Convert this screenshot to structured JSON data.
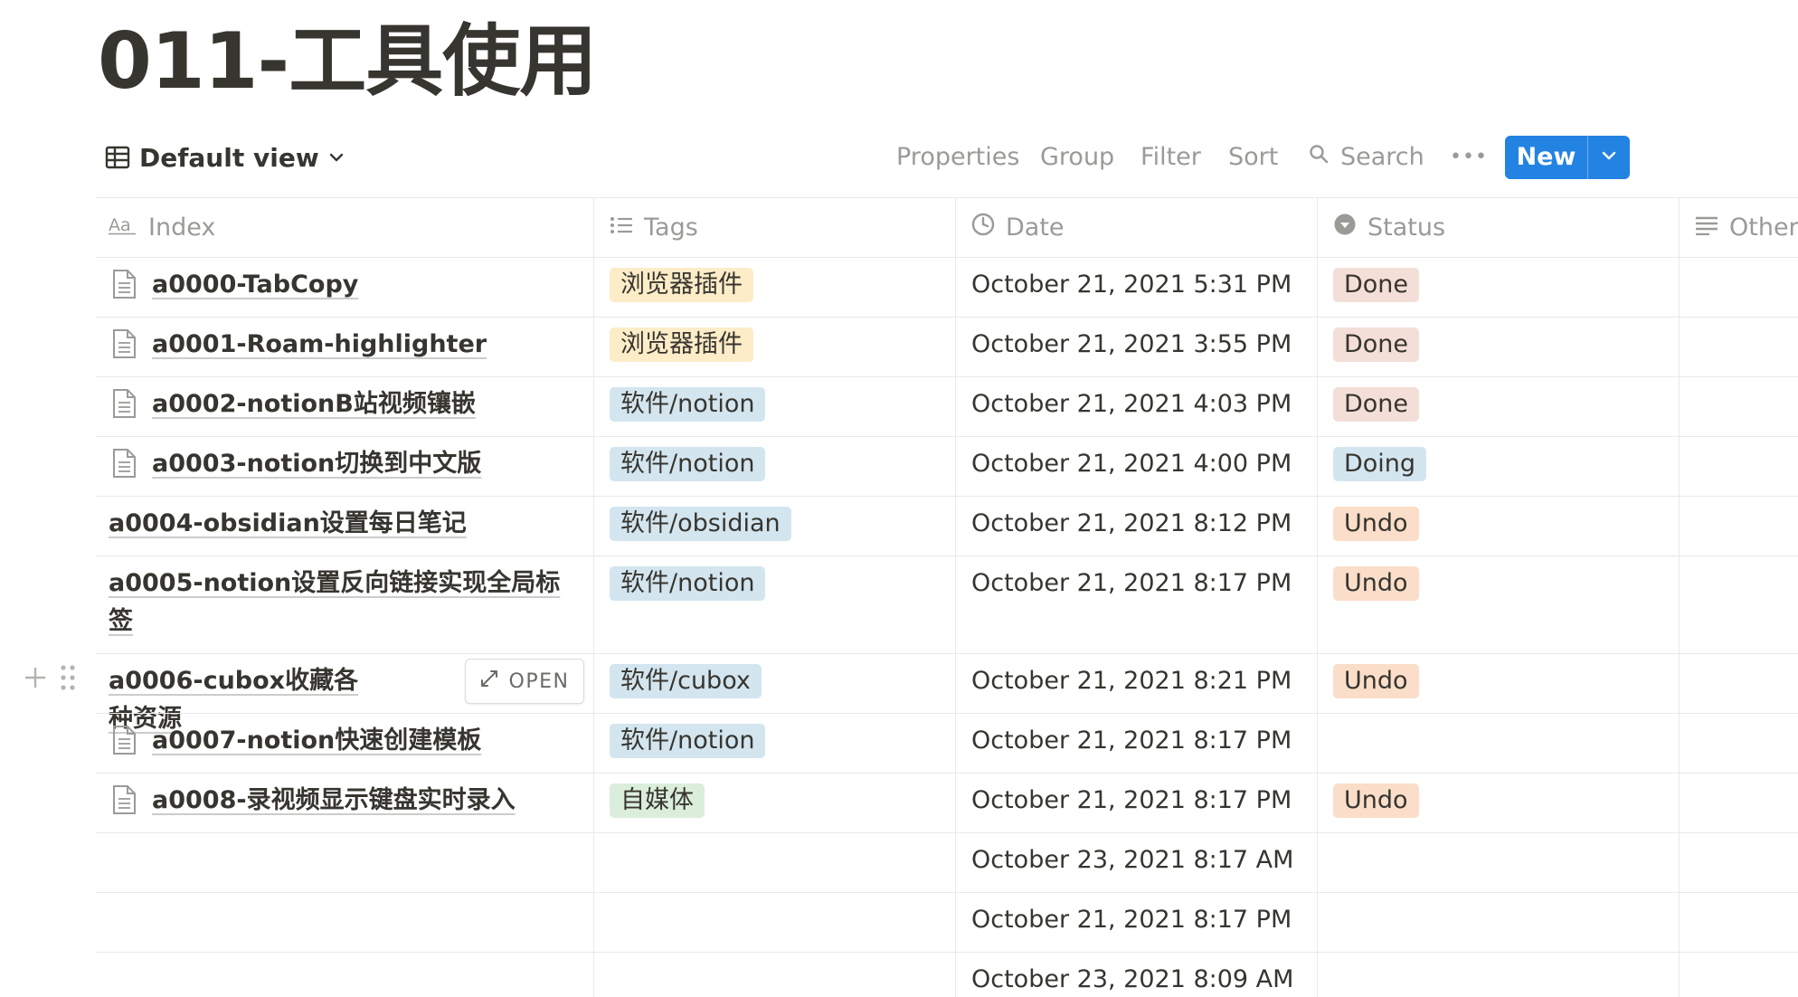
{
  "page": {
    "title": "011-工具使用"
  },
  "toolbar": {
    "view_label": "Default view",
    "properties": "Properties",
    "group": "Group",
    "filter": "Filter",
    "sort": "Sort",
    "search": "Search",
    "more": "•••",
    "new": "New"
  },
  "columns": {
    "index": "Index",
    "tags": "Tags",
    "date": "Date",
    "status": "Status",
    "other": "Other"
  },
  "row_hover": {
    "open_label": "OPEN"
  },
  "rows": [
    {
      "name": "a0000-TabCopy",
      "has_icon": true,
      "tag": "浏览器插件",
      "tag_color": "#fdecc8",
      "date": "October 21, 2021 5:31 PM",
      "status": "Done",
      "status_color": "#f4dfd8"
    },
    {
      "name": "a0001-Roam-highlighter",
      "has_icon": true,
      "tag": "浏览器插件",
      "tag_color": "#fdecc8",
      "date": "October 21, 2021 3:55 PM",
      "status": "Done",
      "status_color": "#f4dfd8"
    },
    {
      "name": "a0002-notionB站视频镶嵌",
      "has_icon": true,
      "tag": "软件/notion",
      "tag_color": "#d3e5ef",
      "date": "October 21, 2021 4:03 PM",
      "status": "Done",
      "status_color": "#f4dfd8"
    },
    {
      "name": "a0003-notion切换到中文版",
      "has_icon": true,
      "tag": "软件/notion",
      "tag_color": "#d3e5ef",
      "date": "October 21, 2021 4:00 PM",
      "status": "Doing",
      "status_color": "#d3e5ef"
    },
    {
      "name": "a0004-obsidian设置每日笔记",
      "has_icon": false,
      "tag": "软件/obsidian",
      "tag_color": "#d3e5ef",
      "date": "October 21, 2021 8:12 PM",
      "status": "Undo",
      "status_color": "#fadec9"
    },
    {
      "name": "a0005-notion设置反向链接实现全局标签",
      "has_icon": false,
      "tag": "软件/notion",
      "tag_color": "#d3e5ef",
      "date": "October 21, 2021 8:17 PM",
      "status": "Undo",
      "status_color": "#fadec9"
    },
    {
      "name": "a0006-cubox收藏各种资源",
      "has_icon": false,
      "tag": "软件/cubox",
      "tag_color": "#d3e5ef",
      "date": "October 21, 2021 8:21 PM",
      "status": "Undo",
      "status_color": "#fadec9"
    },
    {
      "name": "a0007-notion快速创建模板",
      "has_icon": true,
      "tag": "软件/notion",
      "tag_color": "#d3e5ef",
      "date": "October 21, 2021 8:17 PM",
      "status": "",
      "status_color": ""
    },
    {
      "name": "a0008-录视频显示键盘实时录入",
      "has_icon": true,
      "tag": "自媒体",
      "tag_color": "#dbeddb",
      "date": "October 21, 2021 8:17 PM",
      "status": "Undo",
      "status_color": "#fadec9"
    },
    {
      "name": "",
      "has_icon": false,
      "tag": "",
      "tag_color": "",
      "date": "October 23, 2021 8:17 AM",
      "status": "",
      "status_color": ""
    },
    {
      "name": "",
      "has_icon": false,
      "tag": "",
      "tag_color": "",
      "date": "October 21, 2021 8:17 PM",
      "status": "",
      "status_color": ""
    },
    {
      "name": "",
      "has_icon": false,
      "tag": "",
      "tag_color": "",
      "date": "October 23, 2021 8:09 AM",
      "status": "",
      "status_color": ""
    }
  ]
}
